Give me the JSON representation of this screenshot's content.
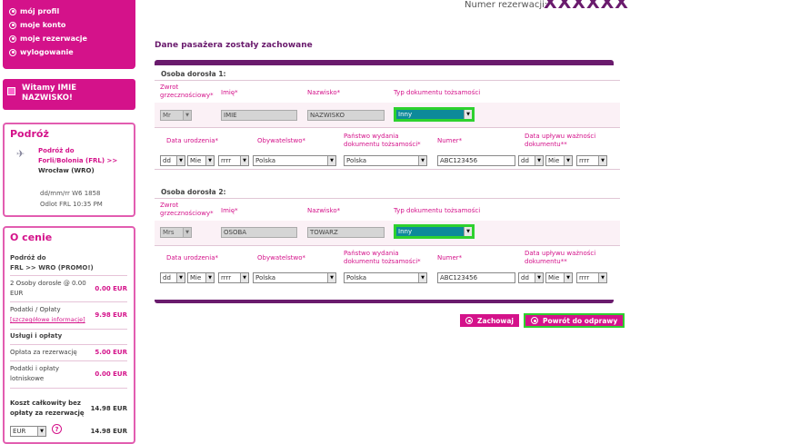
{
  "reservation": {
    "label": "Numer rezerwacji:",
    "code": "XXXXXX"
  },
  "menu": {
    "items": [
      {
        "label": "mój profil"
      },
      {
        "label": "moje konto"
      },
      {
        "label": "moje rezerwacje"
      },
      {
        "label": "wylogowanie"
      }
    ]
  },
  "welcome": {
    "line1": "Witamy IMIE",
    "line2": "NAZWISKO!"
  },
  "trip": {
    "title": "Podróż",
    "route_line1": "Podróż do",
    "route_line2": "Forli/Bolonia (FRL) >>",
    "route_line3": "Wrocław (WRO)",
    "date_line": "dd/mm/rr W6 1858",
    "depart_line": "Odlot FRL 10:35 PM"
  },
  "price": {
    "title": "O cenie",
    "route_label_1": "Podróż do",
    "route_label_2": "FRL >> WRO (PROMO!)",
    "adults_label": "2 Osoby dorosłe @ 0.00 EUR",
    "adults_amount": "0.00 EUR",
    "taxes_label": "Podatki / Opłaty",
    "taxes_link": "[szczegółowe informacje]",
    "taxes_amount": "9.98 EUR",
    "services_title": "Usługi i opłaty",
    "booking_fee_label": "Opłata za rezerwację",
    "booking_fee_amount": "5.00 EUR",
    "airport_tax_label_1": "Podatki i opłaty",
    "airport_tax_label_2": "lotniskowe",
    "airport_tax_amount": "0.00 EUR",
    "total_label_1": "Koszt całkowity bez",
    "total_label_2": "opłaty za rezerwację",
    "total_amount": "14.98 EUR",
    "currency": "EUR",
    "bottom_amount": "14.98 EUR"
  },
  "form": {
    "title": "Dane pasażera zostały zachowane",
    "labels": {
      "title_label_1": "Zwrot",
      "title_label_2": "grzecznościowy*",
      "first_name": "Imię*",
      "last_name": "Nazwisko*",
      "doc_type": "Typ dokumentu tożsamości",
      "birth_date": "Data urodzenia*",
      "citizenship": "Obywatelstwo*",
      "doc_country_1": "Państwo wydania",
      "doc_country_2": "dokumentu tożsamości*",
      "number": "Numer*",
      "expiry_1": "Data upływu ważności",
      "expiry_2": "dokumentu**"
    },
    "passengers": [
      {
        "heading": "Osoba dorosła 1:",
        "title": "Mr",
        "first_name": "IMIE",
        "last_name": "NAZWISKO",
        "doc_type": "Inny",
        "birth_dd": "dd",
        "birth_mm": "Mie",
        "birth_rr": "rrrr",
        "citizenship": "Polska",
        "doc_country": "Polska",
        "number": "ABC123456",
        "exp_dd": "dd",
        "exp_mm": "Mie",
        "exp_rr": "rrrr"
      },
      {
        "heading": "Osoba dorosła 2:",
        "title": "Mrs",
        "first_name": "OSOBA",
        "last_name": "TOWARZ",
        "doc_type": "Inny",
        "birth_dd": "dd",
        "birth_mm": "Mie",
        "birth_rr": "rrrr",
        "citizenship": "Polska",
        "doc_country": "Polska",
        "number": "ABC123456",
        "exp_dd": "dd",
        "exp_mm": "Mie",
        "exp_rr": "rrrr"
      }
    ],
    "buttons": {
      "save": "Zachowaj",
      "return": "Powrót do odprawy"
    }
  },
  "colors": {
    "brand": "#d4128a",
    "dark_purple": "#6a1b6d",
    "highlight": "#2ed12e",
    "selected_bg": "#0d8a9a"
  }
}
